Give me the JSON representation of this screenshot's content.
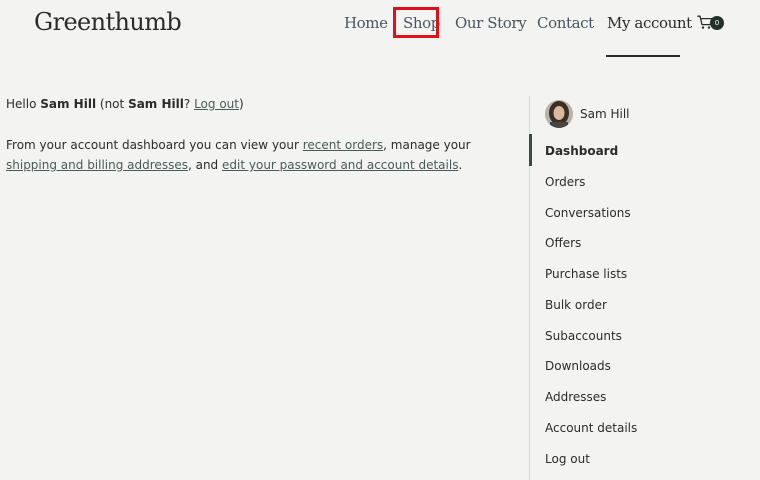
{
  "header": {
    "brand": "Greenthumb",
    "nav": [
      {
        "label": "Home"
      },
      {
        "label": "Shop"
      },
      {
        "label": "Our Story"
      },
      {
        "label": "Contact"
      },
      {
        "label": "My account"
      }
    ],
    "active_nav": "My account",
    "highlighted_nav": "Shop",
    "highlight_color": "#e0101a",
    "cart": {
      "icon": "cart-icon",
      "count": "0"
    }
  },
  "main": {
    "greeting": {
      "hello": "Hello",
      "name": "Sam Hill",
      "not_prefix": "(not",
      "not_name": "Sam Hill",
      "question": "?",
      "logout_link": "Log out",
      "close": ")"
    },
    "intro": {
      "text1": "From your account dashboard you can view your",
      "link_orders": "recent orders",
      "text2": ", manage your",
      "link_addresses": "shipping and billing addresses",
      "text3": ", and",
      "link_account": "edit your password and account details",
      "text4": "."
    }
  },
  "sidebar": {
    "user_name": "Sam Hill",
    "items": [
      {
        "label": "Dashboard",
        "active": true
      },
      {
        "label": "Orders"
      },
      {
        "label": "Conversations"
      },
      {
        "label": "Offers"
      },
      {
        "label": "Purchase lists"
      },
      {
        "label": "Bulk order"
      },
      {
        "label": "Subaccounts"
      },
      {
        "label": "Downloads"
      },
      {
        "label": "Addresses"
      },
      {
        "label": "Account details"
      },
      {
        "label": "Log out"
      }
    ]
  },
  "colors": {
    "background": "#f3f3f1",
    "text": "#2b2b2b",
    "link": "#4a5a5a",
    "badge": "#24302c",
    "active_bar": "#3f4a47"
  }
}
